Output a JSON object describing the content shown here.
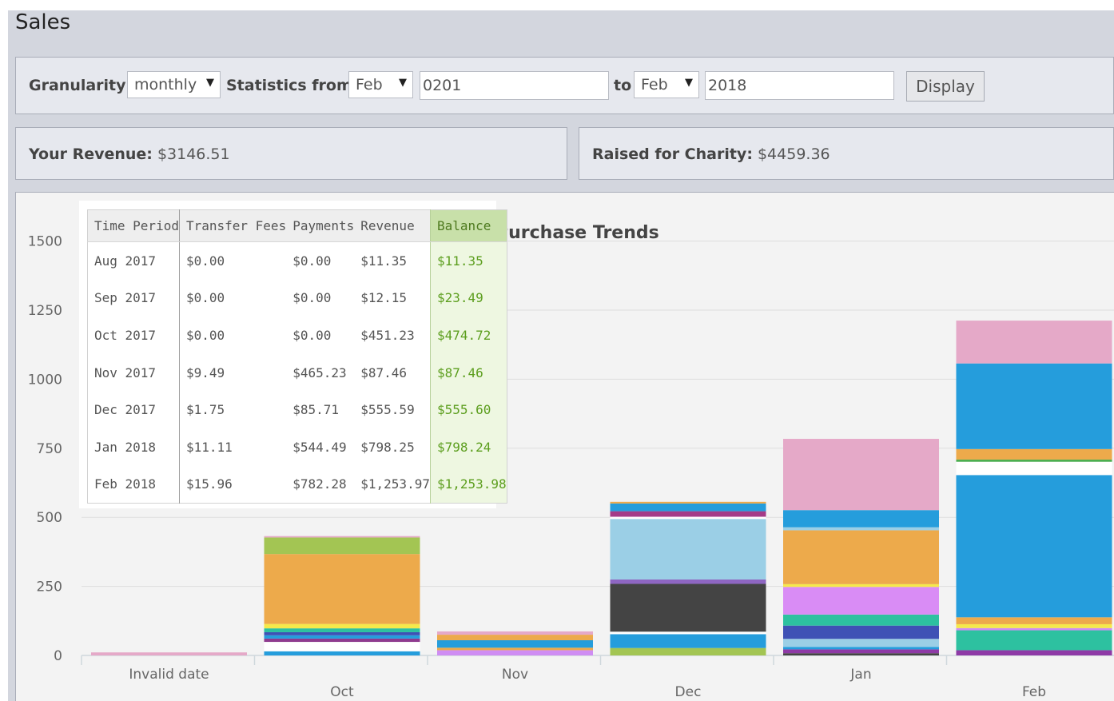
{
  "page_title": "Sales",
  "filters": {
    "granularity_label": "Granularity",
    "granularity_value": "monthly",
    "from_label": "Statistics from",
    "from_month": "Feb",
    "from_year": "0201",
    "to_label": "to",
    "to_month": "Feb",
    "to_year": "2018",
    "display_button": "Display"
  },
  "summary": {
    "revenue_label": "Your Revenue:",
    "revenue_value": "$3146.51",
    "charity_label": "Raised for Charity:",
    "charity_value": "$4459.36"
  },
  "icons": {
    "dropdown_caret": "▼"
  },
  "colors": {
    "balance_header_bg": "#c8e0a9",
    "balance_text": "#5c9e1e",
    "panel_bg": "#e6e8ee"
  },
  "table": {
    "headers": [
      "Time Period",
      "Transfer Fees",
      "Payments",
      "Revenue",
      "Balance"
    ],
    "rows": [
      [
        "Aug 2017",
        "$0.00",
        "$0.00",
        "$11.35",
        "$11.35"
      ],
      [
        "Sep 2017",
        "$0.00",
        "$0.00",
        "$12.15",
        "$23.49"
      ],
      [
        "Oct 2017",
        "$0.00",
        "$0.00",
        "$451.23",
        "$474.72"
      ],
      [
        "Nov 2017",
        "$9.49",
        "$465.23",
        "$87.46",
        "$87.46"
      ],
      [
        "Dec 2017",
        "$1.75",
        "$85.71",
        "$555.59",
        "$555.60"
      ],
      [
        "Jan 2018",
        "$11.11",
        "$544.49",
        "$798.25",
        "$798.24"
      ],
      [
        "Feb 2018",
        "$15.96",
        "$782.28",
        "$1,253.97",
        "$1,253.98"
      ]
    ]
  },
  "chart_data": {
    "type": "bar",
    "stacked": true,
    "title": "Purchase Trends",
    "categories": [
      "Invalid date",
      "Oct",
      "Nov",
      "Dec",
      "Jan",
      "Feb"
    ],
    "ylim": [
      0,
      1600
    ],
    "yticks": [
      0,
      250,
      500,
      750,
      1000,
      1250,
      1500
    ],
    "grid": true,
    "stacks": [
      [
        {
          "value": 11,
          "color": "#e5a9c8"
        }
      ],
      [
        {
          "value": 15,
          "color": "#259ddc"
        },
        {
          "value": 34,
          "color": "#ffffff"
        },
        {
          "value": 12,
          "color": "#8f3b8f"
        },
        {
          "value": 12,
          "color": "#259ddc"
        },
        {
          "value": 11,
          "color": "#3f51b5"
        },
        {
          "value": 14,
          "color": "#2dc1a0"
        },
        {
          "value": 16,
          "color": "#f5e94b"
        },
        {
          "value": 253,
          "color": "#edaa4b"
        },
        {
          "value": 60,
          "color": "#a3c553"
        },
        {
          "value": 5,
          "color": "#e5a9c8"
        }
      ],
      [
        {
          "value": 19,
          "color": "#cf8df3"
        },
        {
          "value": 9,
          "color": "#edaa4b"
        },
        {
          "value": 27,
          "color": "#259ddc"
        },
        {
          "value": 20,
          "color": "#edaa4b"
        },
        {
          "value": 12,
          "color": "#e5a9c8"
        }
      ],
      [
        {
          "value": 27,
          "color": "#a3c553"
        },
        {
          "value": 50,
          "color": "#259ddc"
        },
        {
          "value": 9,
          "color": "#ffffff"
        },
        {
          "value": 173,
          "color": "#444444"
        },
        {
          "value": 16,
          "color": "#8e66c2"
        },
        {
          "value": 219,
          "color": "#9bcfe6"
        },
        {
          "value": 8,
          "color": "#ffffff"
        },
        {
          "value": 20,
          "color": "#a43b88"
        },
        {
          "value": 28,
          "color": "#259ddc"
        },
        {
          "value": 6,
          "color": "#edaa4b"
        }
      ],
      [
        {
          "value": 8,
          "color": "#444444"
        },
        {
          "value": 14,
          "color": "#8e3aa6"
        },
        {
          "value": 9,
          "color": "#259ddc"
        },
        {
          "value": 29,
          "color": "#9bcfe6"
        },
        {
          "value": 48,
          "color": "#3f51b5"
        },
        {
          "value": 40,
          "color": "#2dc1a0"
        },
        {
          "value": 100,
          "color": "#d98cf5"
        },
        {
          "value": 10,
          "color": "#f5e94b"
        },
        {
          "value": 195,
          "color": "#edaa4b"
        },
        {
          "value": 11,
          "color": "#9bcfe6"
        },
        {
          "value": 62,
          "color": "#259ddc"
        },
        {
          "value": 258,
          "color": "#e5a9c8"
        }
      ],
      [
        {
          "value": 19,
          "color": "#8e3aa6"
        },
        {
          "value": 72,
          "color": "#2dc1a0"
        },
        {
          "value": 8,
          "color": "#cf8df3"
        },
        {
          "value": 14,
          "color": "#f5e94b"
        },
        {
          "value": 25,
          "color": "#edaa4b"
        },
        {
          "value": 515,
          "color": "#259ddc"
        },
        {
          "value": 48,
          "color": "#ffffff"
        },
        {
          "value": 8,
          "color": "#4caf50"
        },
        {
          "value": 38,
          "color": "#edaa4b"
        },
        {
          "value": 310,
          "color": "#259ddc"
        },
        {
          "value": 155,
          "color": "#e5a9c8"
        }
      ]
    ]
  }
}
